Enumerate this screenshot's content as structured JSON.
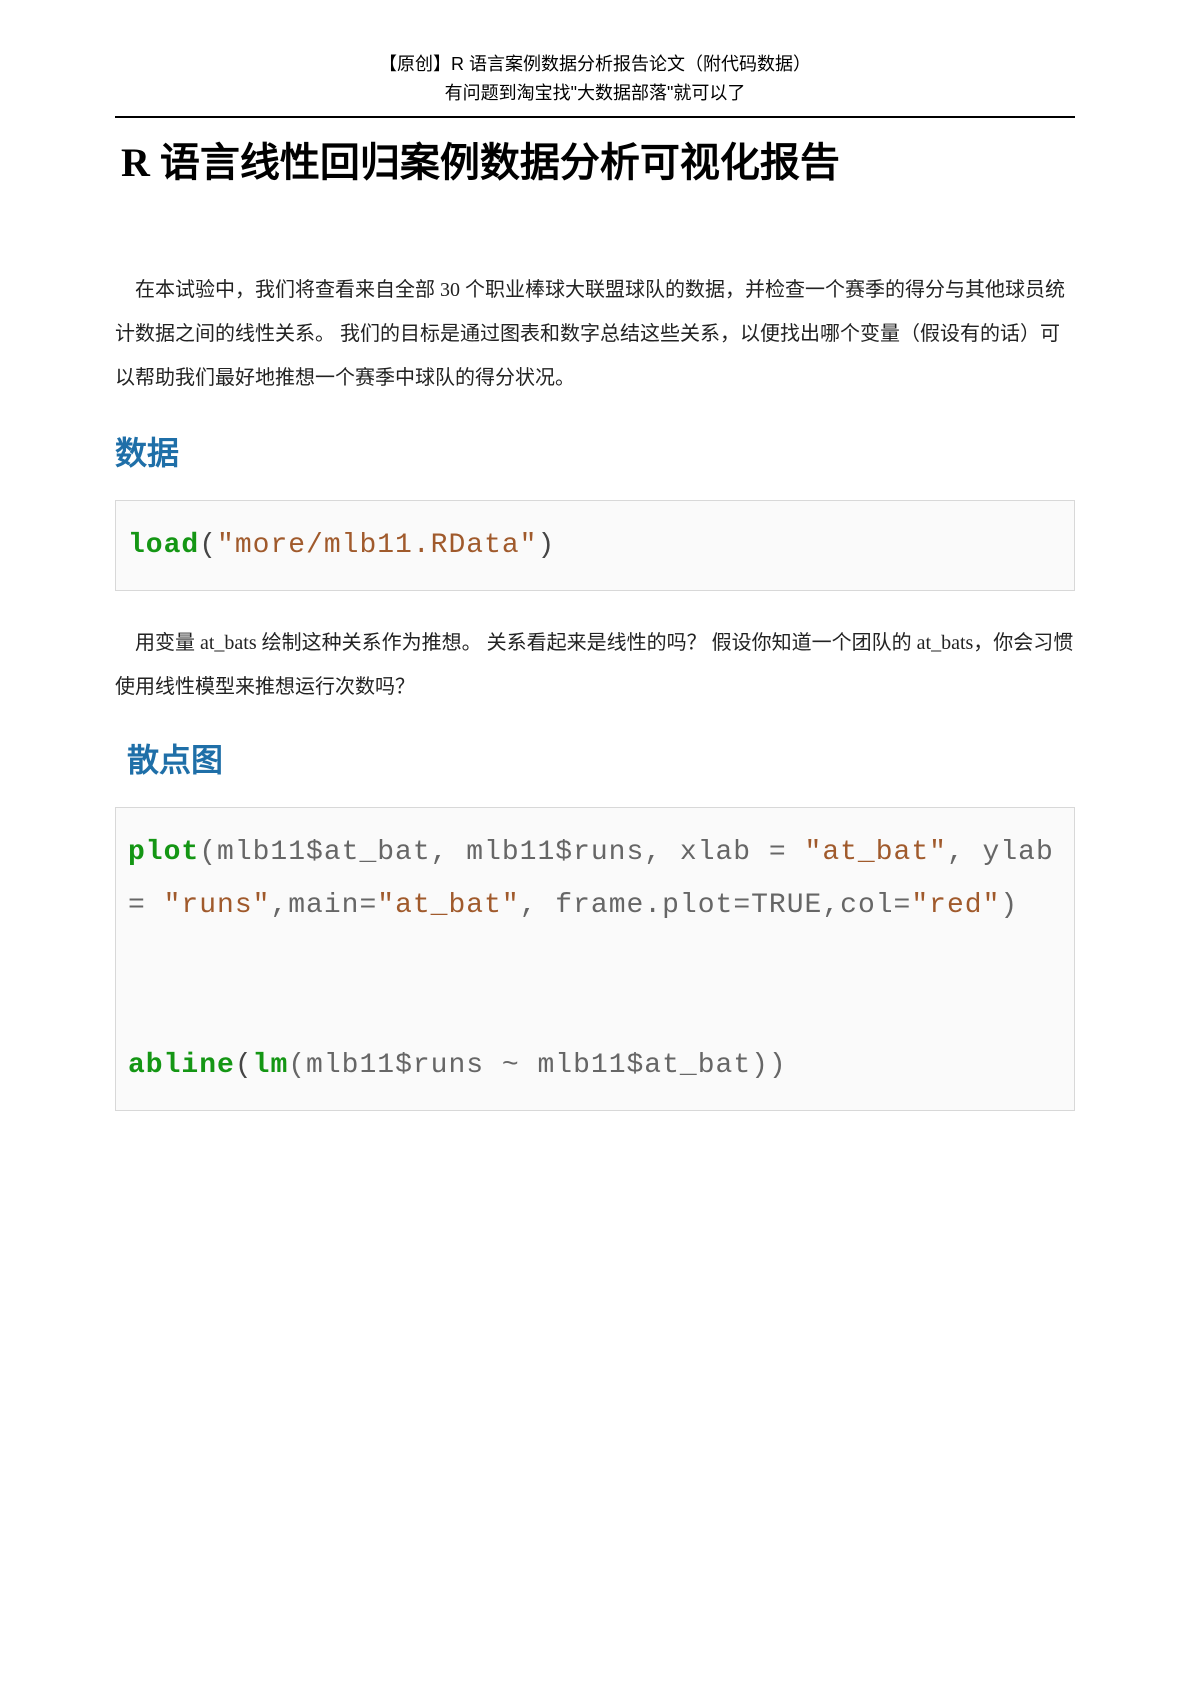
{
  "header": {
    "line1": "【原创】R 语言案例数据分析报告论文（附代码数据）",
    "line2": "有问题到淘宝找\"大数据部落\"就可以了"
  },
  "title": "R 语言线性回归案例数据分析可视化报告",
  "intro": "在本试验中，我们将查看来自全部 30 个职业棒球大联盟球队的数据，并检查一个赛季的得分与其他球员统计数据之间的线性关系。 我们的目标是通过图表和数字总结这些关系，以便找出哪个变量（假设有的话）可以帮助我们最好地推想一个赛季中球队的得分状况。",
  "section1": {
    "heading": "数据",
    "code": {
      "fn": "load",
      "open": "(",
      "arg": "\"more/mlb11.RData\"",
      "close": ")"
    }
  },
  "body2": "用变量 at_bats 绘制这种关系作为推想。 关系看起来是线性的吗？  假设你知道一个团队的 at_bats，你会习惯使用线性模型来推想运行次数吗？",
  "section2": {
    "heading": "散点图",
    "code": {
      "fn1": "plot",
      "args1a": "(mlb11$at_bat,  mlb11$runs, xlab = ",
      "str1": "\"at_bat\"",
      "args1b": ", ylab = ",
      "str2": "\"runs\"",
      "args1c": ",main=",
      "str3": "\"at_bat\"",
      "args1d": ", frame.plot=TRUE,col=",
      "str4": "\"red\"",
      "args1e": ")",
      "fn2": "abline",
      "open2": "(",
      "fn3": "lm",
      "args2": "(mlb11$runs ~ mlb11$at_bat))"
    }
  }
}
